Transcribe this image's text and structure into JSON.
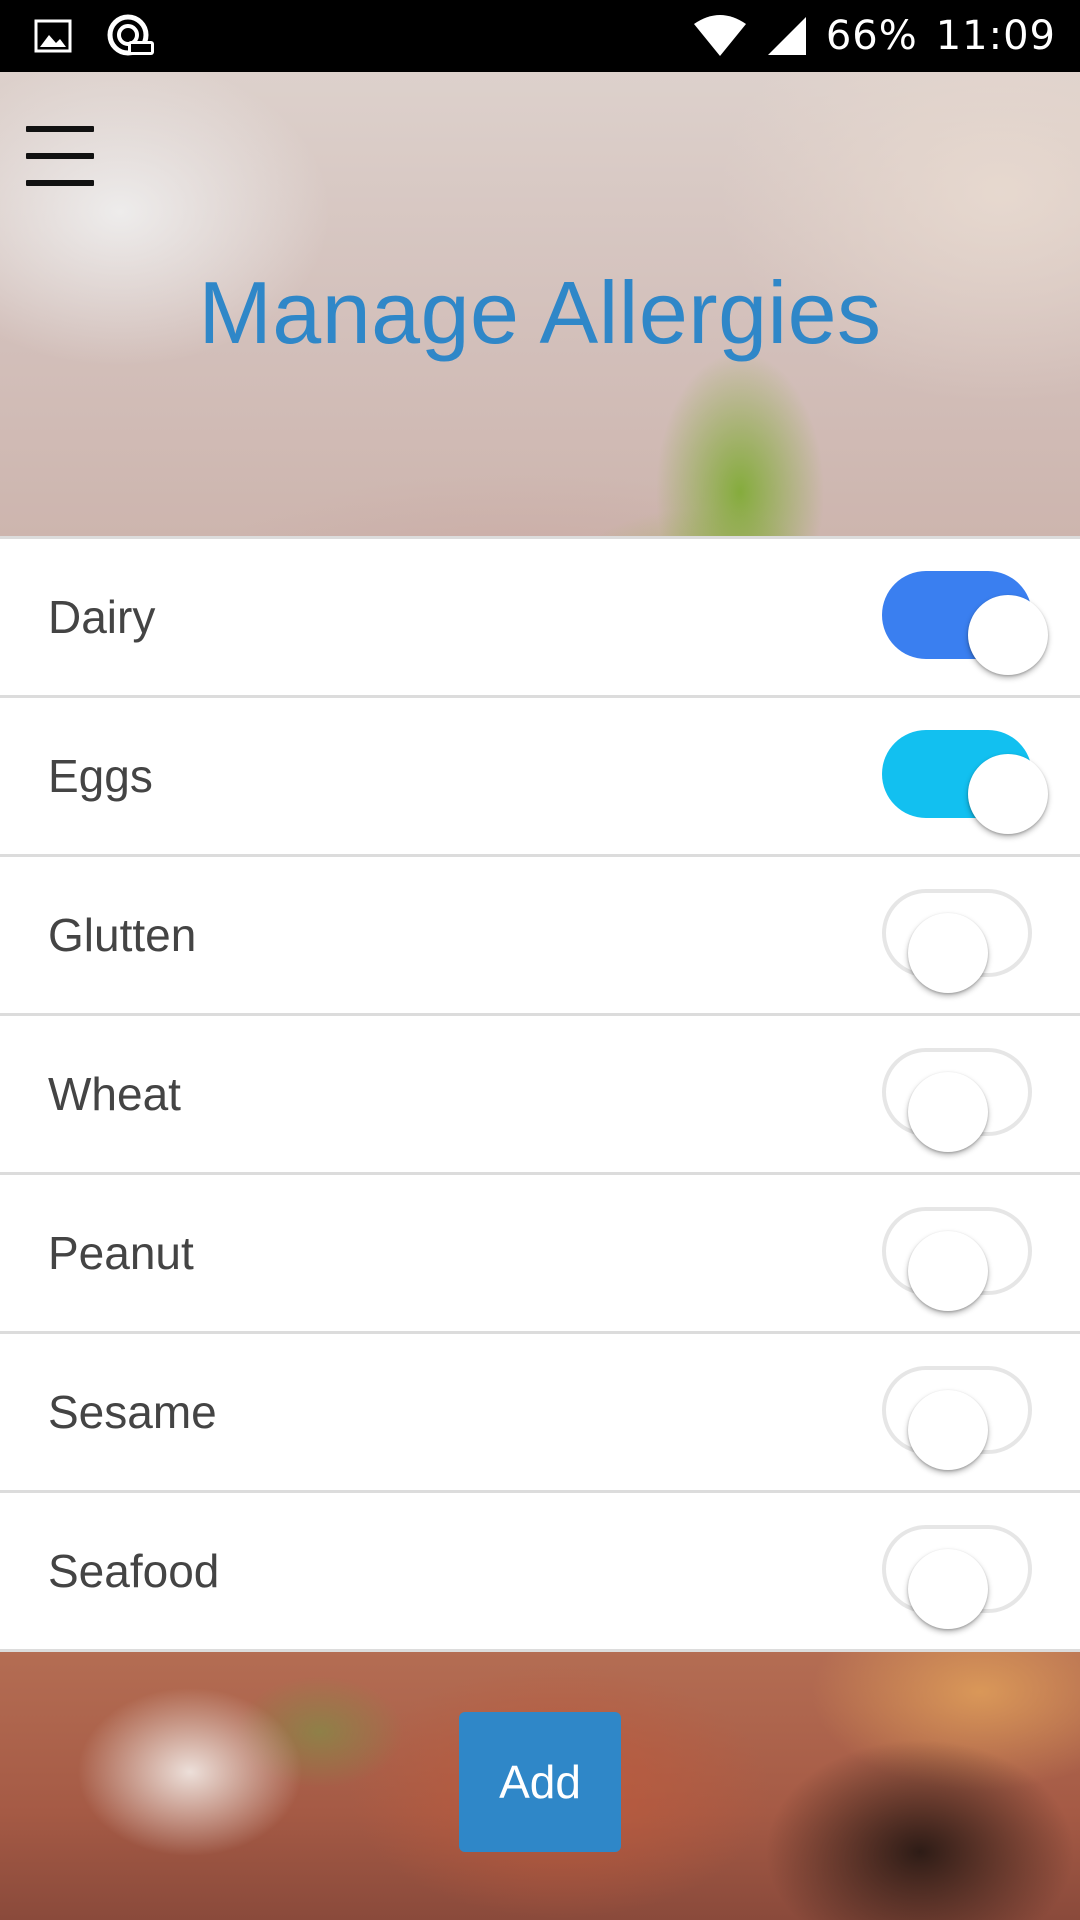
{
  "status_bar": {
    "battery": "66%",
    "time": "11:09",
    "icons": [
      "image-icon",
      "css-app-icon",
      "wifi-icon",
      "cell-signal-icon"
    ]
  },
  "header": {
    "title": "Manage Allergies",
    "menu_icon": "hamburger-menu-icon"
  },
  "colors": {
    "title": "#2f87c8",
    "toggle_on_blue": "#3a7ff0",
    "toggle_on_cyan": "#12c0f0",
    "add_button": "#2f87c8"
  },
  "allergies": [
    {
      "label": "Dairy",
      "enabled": true,
      "color": "#3a7ff0"
    },
    {
      "label": "Eggs",
      "enabled": true,
      "color": "#12c0f0"
    },
    {
      "label": "Glutten",
      "enabled": false
    },
    {
      "label": "Wheat",
      "enabled": false
    },
    {
      "label": "Peanut",
      "enabled": false
    },
    {
      "label": "Sesame",
      "enabled": false
    },
    {
      "label": "Seafood",
      "enabled": false
    }
  ],
  "footer": {
    "add_label": "Add"
  }
}
